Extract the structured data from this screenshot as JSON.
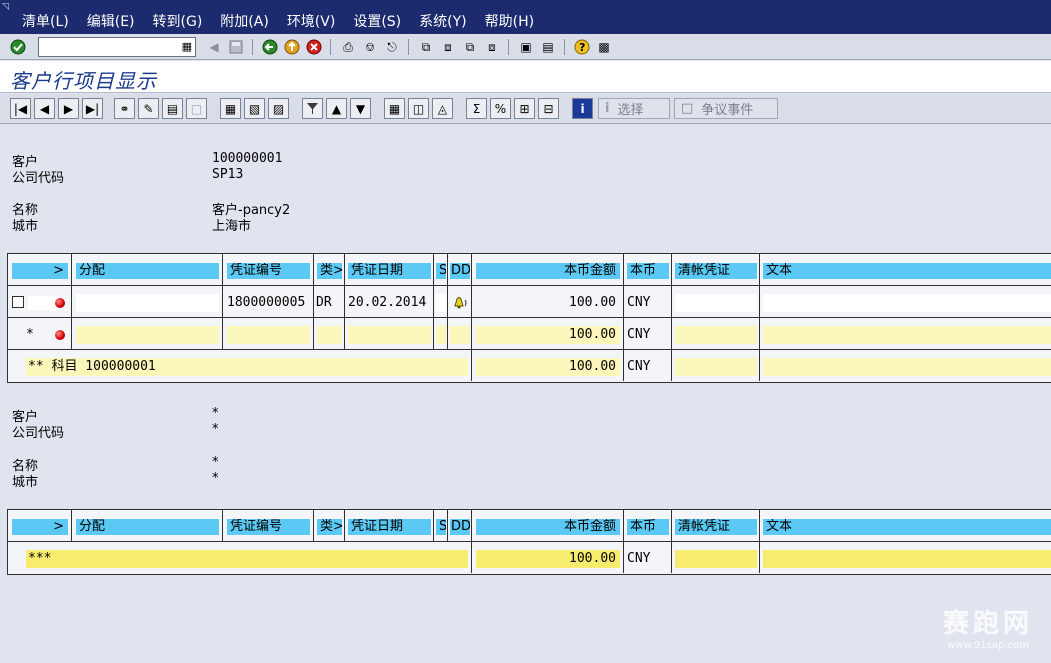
{
  "menu": {
    "corner_icon": "window-menu-icon",
    "items": [
      "清单(L)",
      "编辑(E)",
      "转到(G)",
      "附加(A)",
      "环境(V)",
      "设置(S)",
      "系统(Y)",
      "帮助(H)"
    ]
  },
  "command_field": {
    "value": ""
  },
  "title": "客户行项目显示",
  "app_toolbar": {
    "select_label": "选择",
    "dispute_label": "争议事件"
  },
  "block1": {
    "customer_label": "客户",
    "customer_value": "100000001",
    "company_label": "公司代码",
    "company_value": "SP13",
    "name_label": "名称",
    "name_value": "客户-pancy2",
    "city_label": "城市",
    "city_value": "上海市"
  },
  "columns": {
    "arrow": ">",
    "assignment": "分配",
    "doc_no": "凭证编号",
    "type": "类>",
    "doc_date": "凭证日期",
    "s": "S",
    "dd": "DD",
    "amount": "本币金额",
    "currency": "本币",
    "clearing": "清帐凭证",
    "text": "文本"
  },
  "table1": {
    "row1": {
      "doc_no": "1800000005",
      "type": "DR",
      "doc_date": "20.02.2014",
      "amount": "100.00",
      "currency": "CNY"
    },
    "row2": {
      "marker": "*",
      "amount": "100.00",
      "currency": "CNY"
    },
    "row3": {
      "label": "** 科目 100000001",
      "amount": "100.00",
      "currency": "CNY"
    }
  },
  "block2": {
    "customer_label": "客户",
    "customer_value": "*",
    "company_label": "公司代码",
    "company_value": "*",
    "name_label": "名称",
    "name_value": "*",
    "city_label": "城市",
    "city_value": "*"
  },
  "table2": {
    "total": {
      "label": "***",
      "amount": "100.00",
      "currency": "CNY"
    }
  },
  "watermark": {
    "brand": "赛跑网",
    "url": "www.91sap.com"
  }
}
